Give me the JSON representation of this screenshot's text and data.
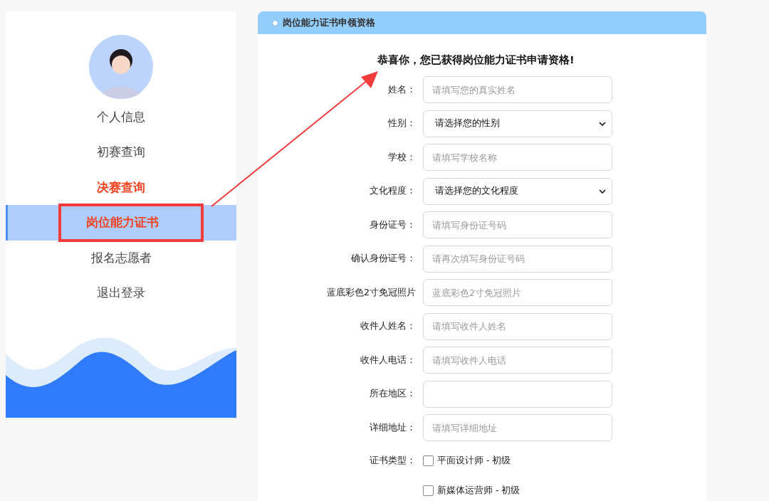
{
  "sidebar": {
    "items": [
      {
        "label": "个人信息",
        "selected": false,
        "highlighted": false
      },
      {
        "label": "初赛查询",
        "selected": false,
        "highlighted": false
      },
      {
        "label": "决赛查询",
        "selected": false,
        "highlighted": true
      },
      {
        "label": "岗位能力证书",
        "selected": true,
        "highlighted": true
      },
      {
        "label": "报名志愿者",
        "selected": false,
        "highlighted": false
      },
      {
        "label": "退出登录",
        "selected": false,
        "highlighted": false
      }
    ]
  },
  "panel": {
    "title": "岗位能力证书申领资格",
    "heading": "恭喜你，您已获得岗位能力证书申请资格!",
    "fields": [
      {
        "kind": "input",
        "label": "姓名：",
        "placeholder": "请填写您的真实姓名"
      },
      {
        "kind": "select",
        "label": "性别：",
        "value": "请选择您的性别"
      },
      {
        "kind": "input",
        "label": "学校：",
        "placeholder": "请填写学校名称"
      },
      {
        "kind": "select",
        "label": "文化程度：",
        "value": "请选择您的文化程度"
      },
      {
        "kind": "input",
        "label": "身份证号：",
        "placeholder": "请填写身份证号码"
      },
      {
        "kind": "input",
        "label": "确认身份证号：",
        "placeholder": "请再次填写身份证号码"
      },
      {
        "kind": "input",
        "label": "蓝底彩色2寸免冠照片",
        "placeholder": "蓝底彩色2寸免冠照片"
      },
      {
        "kind": "input",
        "label": "收件人姓名：",
        "placeholder": "请填写收件人姓名"
      },
      {
        "kind": "input",
        "label": "收件人电话：",
        "placeholder": "请填写收件人电话"
      },
      {
        "kind": "input",
        "label": "所在地区："
      },
      {
        "kind": "input",
        "label": "详细地址：",
        "placeholder": "请填写详细地址"
      },
      {
        "kind": "checkbox",
        "label": "证书类型：",
        "options": [
          {
            "label": "平面设计师 - 初级",
            "checked": false
          },
          {
            "label": "新媒体运营师 - 初级",
            "checked": false
          }
        ]
      }
    ]
  }
}
